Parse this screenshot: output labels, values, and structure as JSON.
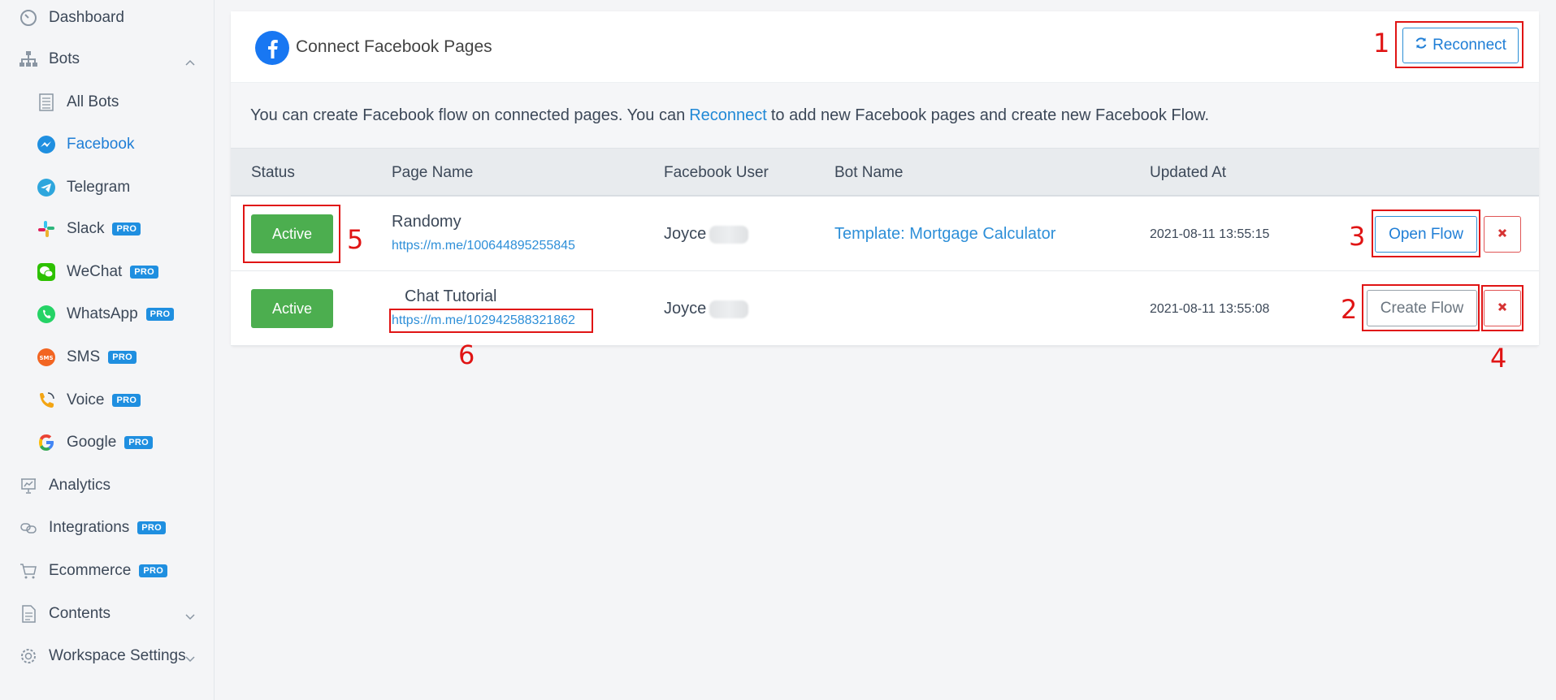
{
  "sidebar": {
    "items": [
      {
        "label": "Dashboard"
      },
      {
        "label": "Bots"
      },
      {
        "label": "All Bots"
      },
      {
        "label": "Facebook"
      },
      {
        "label": "Telegram"
      },
      {
        "label": "Slack",
        "badge": "PRO"
      },
      {
        "label": "WeChat",
        "badge": "PRO"
      },
      {
        "label": "WhatsApp",
        "badge": "PRO"
      },
      {
        "label": "SMS",
        "badge": "PRO"
      },
      {
        "label": "Voice",
        "badge": "PRO"
      },
      {
        "label": "Google",
        "badge": "PRO"
      },
      {
        "label": "Analytics"
      },
      {
        "label": "Integrations",
        "badge": "PRO"
      },
      {
        "label": "Ecommerce",
        "badge": "PRO"
      },
      {
        "label": "Contents"
      },
      {
        "label": "Workspace Settings"
      }
    ]
  },
  "header": {
    "title": "Connect Facebook Pages",
    "reconnect_label": "Reconnect"
  },
  "info": {
    "text_before": "You can create Facebook flow on connected pages. You can",
    "link": "Reconnect",
    "text_after": "to add new Facebook pages and create new Facebook Flow."
  },
  "table": {
    "columns": [
      "Status",
      "Page Name",
      "Facebook User",
      "Bot Name",
      "Updated At"
    ],
    "rows": [
      {
        "status": "Active",
        "page_name": "Randomy",
        "page_url": "https://m.me/100644895255845",
        "facebook_user": "Joyce",
        "bot_name": "Template: Mortgage Calculator",
        "updated_at": "2021-08-11 13:55:15",
        "action": "Open Flow"
      },
      {
        "status": "Active",
        "page_name": "Chat Tutorial",
        "page_url": "https://m.me/102942588321862",
        "facebook_user": "Joyce",
        "bot_name": "",
        "updated_at": "2021-08-11 13:55:08",
        "action": "Create Flow"
      }
    ]
  },
  "annotations": [
    "1",
    "2",
    "3",
    "4",
    "5",
    "6"
  ],
  "colors": {
    "accent": "#1f7ed6",
    "active_green": "#4cae4f",
    "delete_red": "#e05555",
    "annotation_red": "#e01414",
    "pro_badge": "#1f8fe0"
  }
}
